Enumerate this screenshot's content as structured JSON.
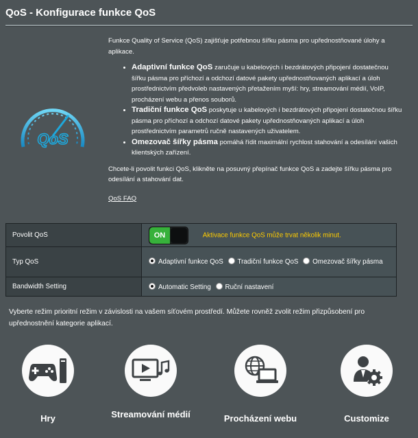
{
  "page": {
    "title": "QoS - Konfigurace funkce QoS"
  },
  "intro": {
    "paragraph": "Funkce Quality of Service (QoS) zajišťuje potřebnou šířku pásma pro upřednostňované úlohy a aplikace.",
    "bullets": [
      {
        "term": "Adaptivní funkce QoS",
        "text": " zaručuje u kabelových i bezdrátových připojení dostatečnou šířku pásma pro příchozí a odchozí datové pakety upřednostňovaných aplikací a úloh prostřednictvím předvoleb nastavených přetažením myší: hry, streamování médií, VoIP, procházení webu a přenos souborů."
      },
      {
        "term": "Tradiční funkce QoS",
        "text": " poskytuje u kabelových i bezdrátových připojení dostatečnou šířku pásma pro příchozí a odchozí datové pakety upřednostňovaných aplikací a úloh prostřednictvím parametrů ručně nastavených uživatelem."
      },
      {
        "term": "Omezovač šířky pásma",
        "text": " pomáhá řídit maximální rychlost stahování a odesílání vašich klientských zařízení."
      }
    ],
    "paragraph2": "Chcete-li povolit funkci QoS, klikněte na posuvný přepínač funkce QoS a zadejte šířku pásma pro odesílání a stahování dat.",
    "faq_link": "QoS FAQ"
  },
  "logo": {
    "text": "QoS"
  },
  "settings": {
    "enable": {
      "label": "Povolit QoS",
      "toggle": "ON",
      "warning": "Aktivace funkce QoS může trvat několik minut."
    },
    "type": {
      "label": "Typ QoS",
      "options": [
        "Adaptivní funkce QoS",
        "Tradiční funkce QoS",
        "Omezovač šířky pásma"
      ],
      "selected": 0
    },
    "bandwidth": {
      "label": "Bandwidth Setting",
      "options": [
        "Automatic Setting",
        "Ruční nastavení"
      ],
      "selected": 0
    }
  },
  "priority": {
    "description": "Vyberte režim prioritní režim v závislosti na vašem síťovém prostředí. Můžete rovněž zvolit režim přizpůsobení pro upřednostnění kategorie aplikací.",
    "modes": [
      {
        "label": "Hry",
        "icon": "gamepad-icon"
      },
      {
        "label": "Streamování médií",
        "icon": "media-streaming-icon"
      },
      {
        "label": "Procházení webu",
        "icon": "web-browsing-icon"
      },
      {
        "label": "Customize",
        "icon": "customize-icon"
      }
    ]
  },
  "colors": {
    "toggle_on": "#37b13b",
    "warning": "#ffcc00",
    "logo_blue": "#1ea8dc"
  }
}
